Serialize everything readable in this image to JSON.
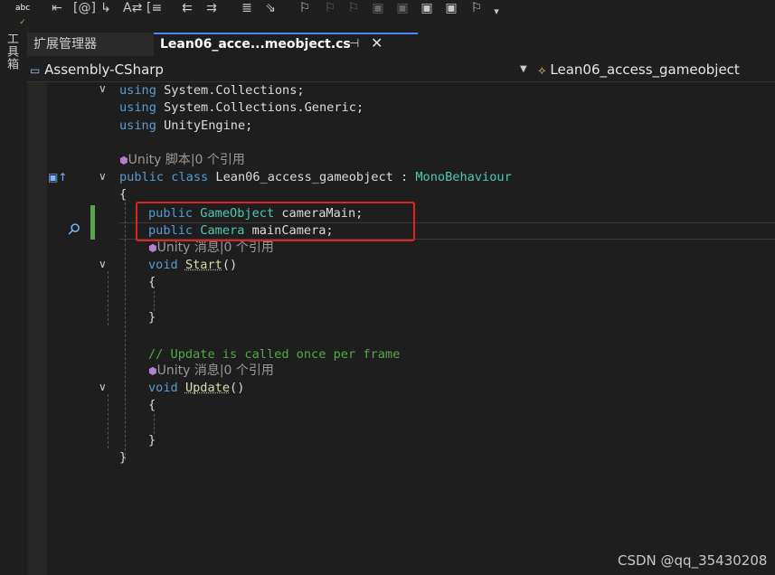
{
  "toolbar": {
    "icons": [
      "spell-check-icon",
      "comment-icon",
      "quick-info-icon",
      "parameter-info-icon",
      "complete-word-icon",
      "indent-icon",
      "outdent-icon",
      "increase-indent-icon",
      "format-document-icon",
      "clear-bookmarks-icon",
      "bookmark-icon",
      "prev-bookmark-icon",
      "next-bookmark-icon",
      "bookmark-folder-icon",
      "prev-folder-bookmark-icon",
      "next-folder-bookmark-icon",
      "more-icon"
    ],
    "overflow_label": "▾"
  },
  "left_strip": {
    "toolbox_label": "工具箱"
  },
  "tabs": [
    {
      "label": "扩展管理器",
      "active": false
    },
    {
      "label": "Lean06_acce...meobject.cs",
      "active": true
    }
  ],
  "navbar": {
    "project": "Assembly-CSharp",
    "class": "Lean06_access_gameobject"
  },
  "editor": {
    "lines": {
      "l1": {
        "kw": "using",
        "rest": " System.Collections;"
      },
      "l2": {
        "kw": "using",
        "rest": " System.Collections.Generic;"
      },
      "l3": {
        "kw": "using",
        "rest": " UnityEngine;"
      },
      "lens1": "Unity 脚本|0 个引用",
      "l5a": "public",
      "l5b": "class",
      "l5c": " Lean06_access_gameobject : ",
      "l5d": "MonoBehaviour",
      "l6": "{",
      "l7a": "public",
      "l7b": "GameObject",
      "l7c": " cameraMain;",
      "l8a": "public",
      "l8b": "Camera",
      "l8c": " mainCamera;",
      "lens2": "Unity 消息|0 个引用",
      "l9a": "void",
      "l9b": "Start",
      "l9c": "()",
      "l10": "{",
      "l11": "}",
      "l12": "// Update is called once per frame",
      "lens3": "Unity 消息|0 个引用",
      "l13a": "void",
      "l13b": "Update",
      "l13c": "()",
      "l14": "{",
      "l15": "}",
      "l16": "}"
    }
  },
  "watermark": "CSDN @qq_35430208",
  "colors": {
    "keyword": "#569cd6",
    "type": "#4ec9b0",
    "comment": "#57a64a",
    "highlight_box": "#e02424"
  }
}
